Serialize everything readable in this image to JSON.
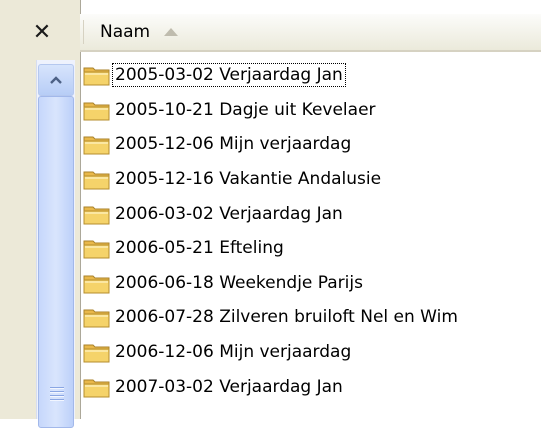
{
  "toolbar": {
    "close_glyph": "✕",
    "close_icon": "close-icon"
  },
  "list": {
    "column_header": "Naam",
    "sort": "ascending",
    "items": [
      {
        "label": "2005-03-02 Verjaardag Jan",
        "icon": "folder-icon"
      },
      {
        "label": "2005-10-21 Dagje uit Kevelaer",
        "icon": "folder-icon"
      },
      {
        "label": "2005-12-06 Mijn verjaardag",
        "icon": "folder-icon"
      },
      {
        "label": "2005-12-16 Vakantie Andalusie",
        "icon": "folder-icon"
      },
      {
        "label": "2006-03-02 Verjaardag Jan",
        "icon": "folder-icon"
      },
      {
        "label": "2006-05-21 Efteling",
        "icon": "folder-icon"
      },
      {
        "label": "2006-06-18 Weekendje Parijs",
        "icon": "folder-icon"
      },
      {
        "label": "2006-07-28 Zilveren bruiloft Nel en Wim",
        "icon": "folder-icon"
      },
      {
        "label": "2006-12-06 Mijn verjaardag",
        "icon": "folder-icon"
      },
      {
        "label": "2007-03-02 Verjaardag Jan",
        "icon": "folder-icon"
      }
    ]
  },
  "colors": {
    "pane_bg": "#ece9d8",
    "scrollbar_blue": "#c6d7fb",
    "folder_yellow": "#f5d36a"
  }
}
